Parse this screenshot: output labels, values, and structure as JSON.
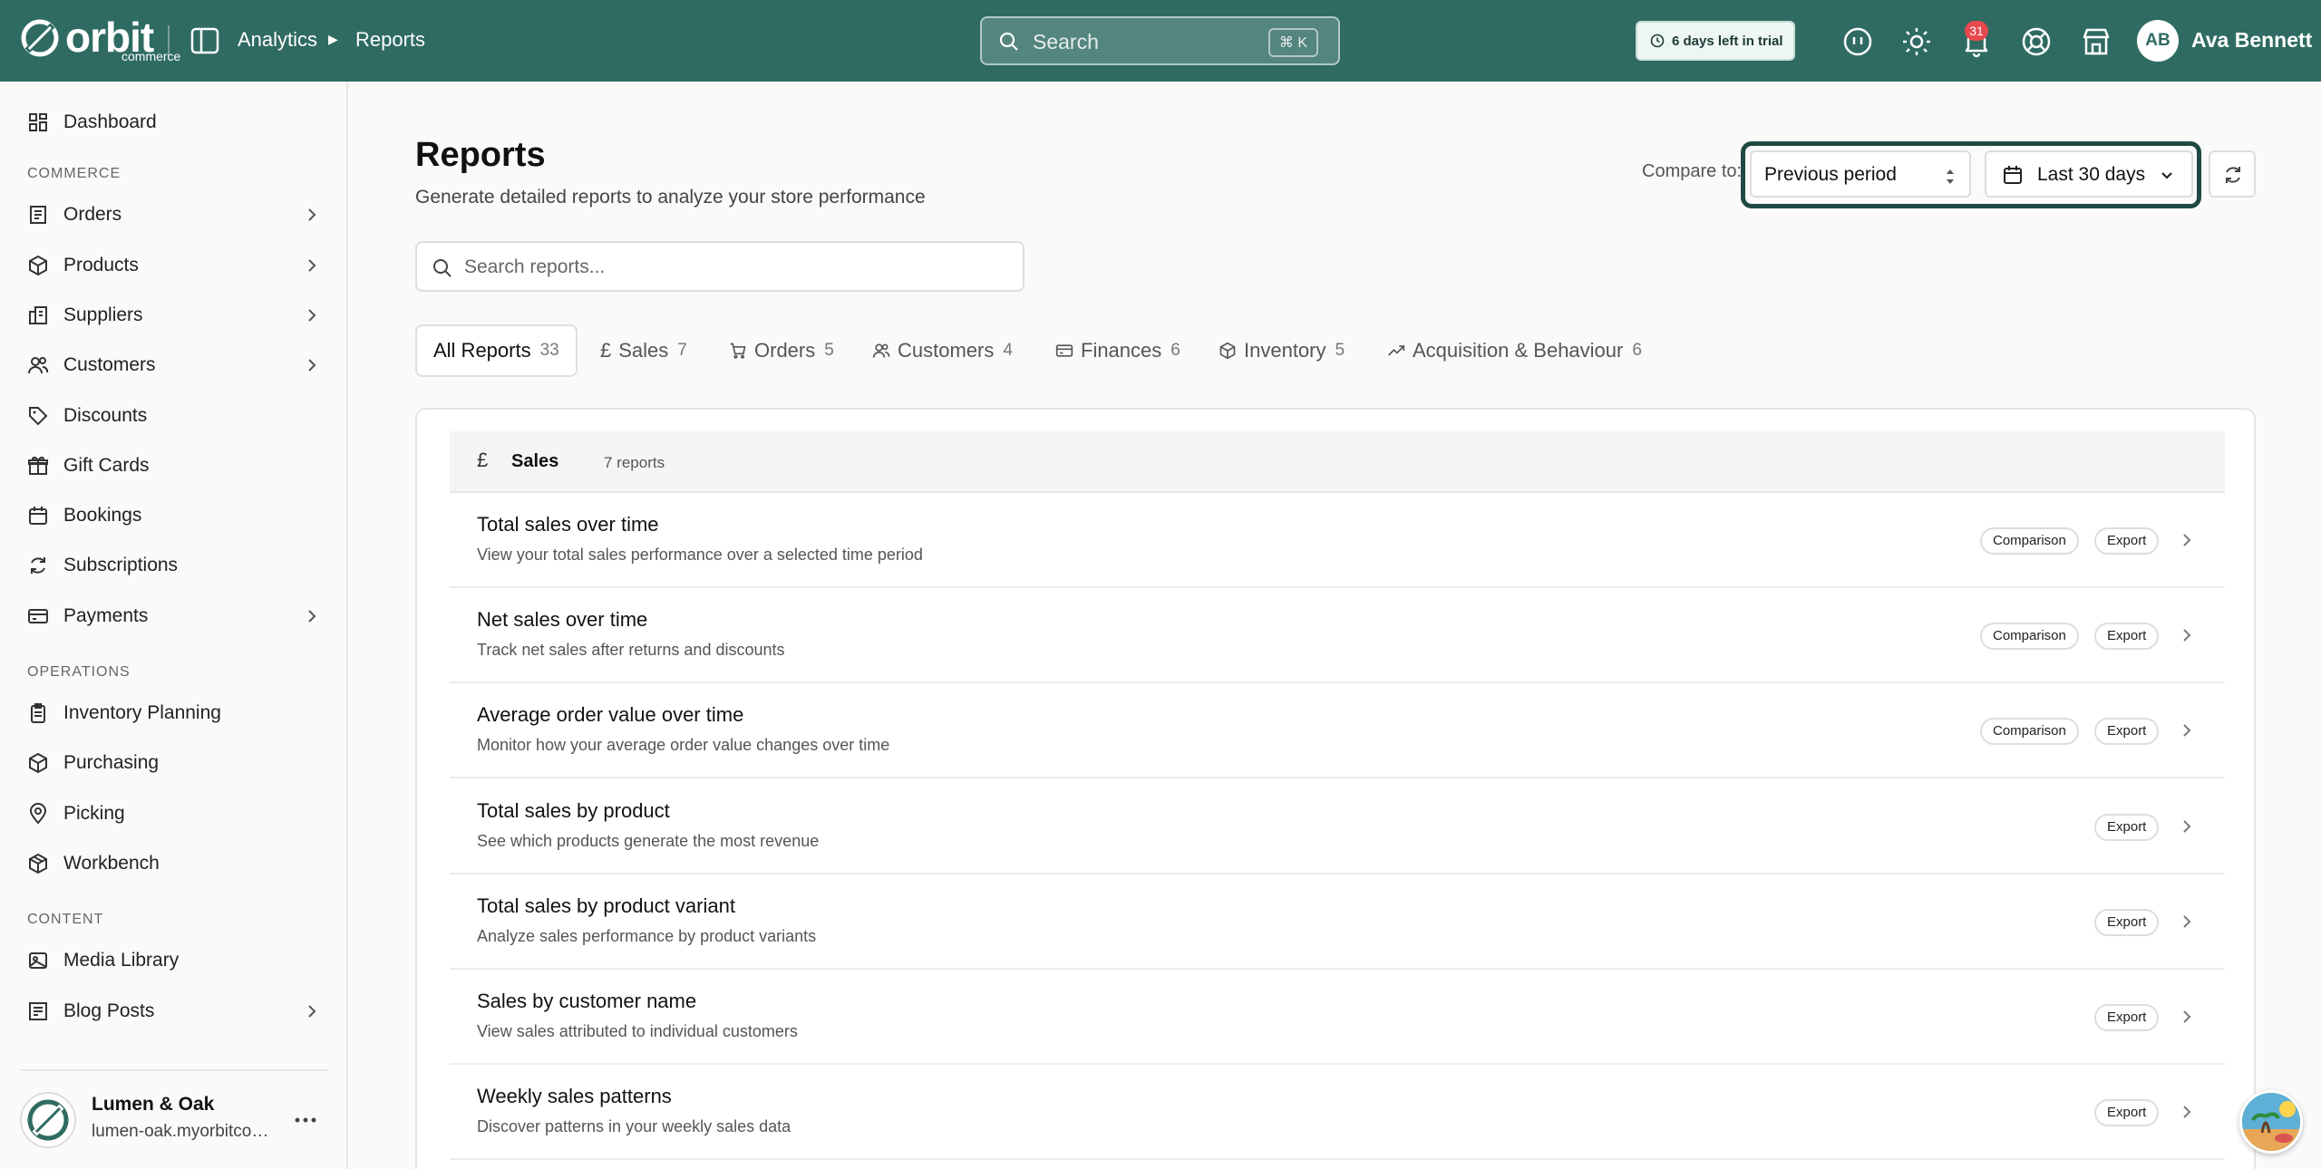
{
  "app": {
    "logo_text": "orbit",
    "logo_sub": "commerce",
    "colors": {
      "topbar": "#2f6b62",
      "accent_focus": "#1d4a42",
      "badge": "#e5484d"
    }
  },
  "breadcrumb": {
    "parent": "Analytics",
    "current": "Reports"
  },
  "search": {
    "placeholder": "Search",
    "shortcut": "⌘ K"
  },
  "trial": {
    "text": "6 days left in trial"
  },
  "topbar_icons": [
    "ai-assistant-icon",
    "theme-sun-icon",
    "bell-icon",
    "help-lifebuoy-icon",
    "store-icon"
  ],
  "notifications": {
    "count": "31"
  },
  "user": {
    "initials": "AB",
    "name": "Ava Bennett"
  },
  "sidebar": {
    "top": [
      {
        "label": "Dashboard",
        "icon": "dashboard-icon"
      }
    ],
    "sections": [
      {
        "title": "COMMERCE",
        "items": [
          {
            "label": "Orders",
            "icon": "orders-icon",
            "has_children": true
          },
          {
            "label": "Products",
            "icon": "products-icon",
            "has_children": true
          },
          {
            "label": "Suppliers",
            "icon": "suppliers-icon",
            "has_children": true
          },
          {
            "label": "Customers",
            "icon": "customers-icon",
            "has_children": true
          },
          {
            "label": "Discounts",
            "icon": "tag-icon",
            "has_children": false
          },
          {
            "label": "Gift Cards",
            "icon": "gift-icon",
            "has_children": false
          },
          {
            "label": "Bookings",
            "icon": "calendar-icon",
            "has_children": false
          },
          {
            "label": "Subscriptions",
            "icon": "refresh-icon",
            "has_children": false
          },
          {
            "label": "Payments",
            "icon": "card-icon",
            "has_children": true
          }
        ]
      },
      {
        "title": "OPERATIONS",
        "items": [
          {
            "label": "Inventory Planning",
            "icon": "clipboard-icon",
            "has_children": false
          },
          {
            "label": "Purchasing",
            "icon": "box-icon",
            "has_children": false
          },
          {
            "label": "Picking",
            "icon": "pin-icon",
            "has_children": false
          },
          {
            "label": "Workbench",
            "icon": "cube-icon",
            "has_children": false
          }
        ]
      },
      {
        "title": "CONTENT",
        "items": [
          {
            "label": "Media Library",
            "icon": "image-icon",
            "has_children": false
          },
          {
            "label": "Blog Posts",
            "icon": "blog-icon",
            "has_children": true
          }
        ]
      }
    ]
  },
  "store": {
    "name": "Lumen & Oak",
    "url": "lumen-oak.myorbitcommerce.com"
  },
  "page": {
    "title": "Reports",
    "subtitle": "Generate detailed reports to analyze your store performance",
    "compare_label": "Compare to:",
    "compare_value": "Previous period",
    "date_range": "Last 30 days",
    "report_search_placeholder": "Search reports..."
  },
  "tabs": [
    {
      "label": "All Reports",
      "count": "33",
      "icon": "",
      "active": true
    },
    {
      "label": "Sales",
      "count": "7",
      "icon": "pound-icon"
    },
    {
      "label": "Orders",
      "count": "5",
      "icon": "cart-icon"
    },
    {
      "label": "Customers",
      "count": "4",
      "icon": "users-icon"
    },
    {
      "label": "Finances",
      "count": "6",
      "icon": "card-icon"
    },
    {
      "label": "Inventory",
      "count": "5",
      "icon": "box-icon"
    },
    {
      "label": "Acquisition & Behaviour",
      "count": "6",
      "icon": "trend-icon"
    }
  ],
  "group": {
    "name": "Sales",
    "count": "7 reports",
    "icon": "pound-icon"
  },
  "tag_labels": {
    "comparison": "Comparison",
    "export": "Export"
  },
  "reports": [
    {
      "title": "Total sales over time",
      "desc": "View your total sales performance over a selected time period",
      "comparison": true
    },
    {
      "title": "Net sales over time",
      "desc": "Track net sales after returns and discounts",
      "comparison": true
    },
    {
      "title": "Average order value over time",
      "desc": "Monitor how your average order value changes over time",
      "comparison": true
    },
    {
      "title": "Total sales by product",
      "desc": "See which products generate the most revenue",
      "comparison": false
    },
    {
      "title": "Total sales by product variant",
      "desc": "Analyze sales performance by product variants",
      "comparison": false
    },
    {
      "title": "Sales by customer name",
      "desc": "View sales attributed to individual customers",
      "comparison": false
    },
    {
      "title": "Weekly sales patterns",
      "desc": "Discover patterns in your weekly sales data",
      "comparison": false
    }
  ]
}
